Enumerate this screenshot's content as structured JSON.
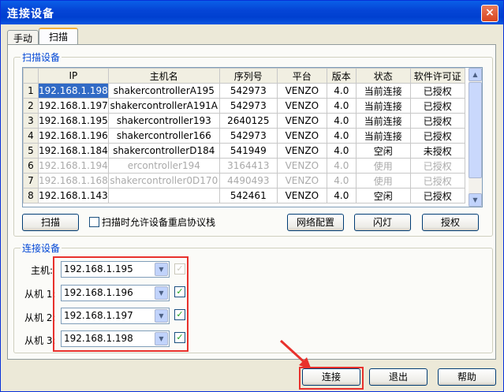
{
  "window": {
    "title": "连接设备",
    "close_label": "×"
  },
  "tabs": [
    {
      "label": "手动"
    },
    {
      "label": "扫描"
    }
  ],
  "scan_group": {
    "title": "扫描设备",
    "columns": [
      "",
      "IP",
      "主机名",
      "序列号",
      "平台",
      "版本",
      "状态",
      "软件许可证"
    ],
    "rows": [
      {
        "n": "1",
        "ip": "192.168.1.198",
        "host": "shakercontrollerA195",
        "serial": "542973",
        "platform": "VENZO",
        "version": "4.0",
        "status": "当前连接",
        "license": "已授权"
      },
      {
        "n": "2",
        "ip": "192.168.1.197",
        "host": "shakercontrollerA191A",
        "serial": "542973",
        "platform": "VENZO",
        "version": "4.0",
        "status": "当前连接",
        "license": "已授权"
      },
      {
        "n": "3",
        "ip": "192.168.1.195",
        "host": "shakercontroller193",
        "serial": "2640125",
        "platform": "VENZO",
        "version": "4.0",
        "status": "当前连接",
        "license": "已授权"
      },
      {
        "n": "4",
        "ip": "192.168.1.196",
        "host": "shakercontroller166",
        "serial": "542973",
        "platform": "VENZO",
        "version": "4.0",
        "status": "当前连接",
        "license": "已授权"
      },
      {
        "n": "5",
        "ip": "192.168.1.184",
        "host": "shakercontrollerD184",
        "serial": "541949",
        "platform": "VENZO",
        "version": "4.0",
        "status": "空闲",
        "license": "未授权"
      },
      {
        "n": "6",
        "ip": "192.168.1.194",
        "host": "ercontroller194",
        "serial": "3164413",
        "platform": "VENZO",
        "version": "4.0",
        "status": "使用",
        "license": "已授权"
      },
      {
        "n": "7",
        "ip": "192.168.1.168",
        "host": "shakercontroller0D170",
        "serial": "4490493",
        "platform": "VENZO",
        "version": "4.0",
        "status": "使用",
        "license": "已授权"
      },
      {
        "n": "8",
        "ip": "192.168.1.143",
        "host": "",
        "serial": "542461",
        "platform": "VENZO",
        "version": "4.0",
        "status": "空闲",
        "license": "已授权"
      }
    ],
    "scan_button": "扫描",
    "allow_reboot_label": "扫描时允许设备重启协议栈",
    "network_button": "网络配置",
    "blink_button": "闪灯",
    "license_button": "授权"
  },
  "connect_group": {
    "title": "连接设备",
    "rows": [
      {
        "label": "主机:",
        "value": "192.168.1.195",
        "checked": true,
        "disabled": true
      },
      {
        "label": "从机 1:",
        "value": "192.168.1.196",
        "checked": true,
        "disabled": false
      },
      {
        "label": "从机 2:",
        "value": "192.168.1.197",
        "checked": true,
        "disabled": false
      },
      {
        "label": "从机 3:",
        "value": "192.168.1.198",
        "checked": true,
        "disabled": false
      }
    ]
  },
  "footer": {
    "connect_button": "连接",
    "exit_button": "退出",
    "help_button": "帮助"
  },
  "icons": {
    "combo_arrow": "chevron-down-icon",
    "check": "check-icon"
  }
}
